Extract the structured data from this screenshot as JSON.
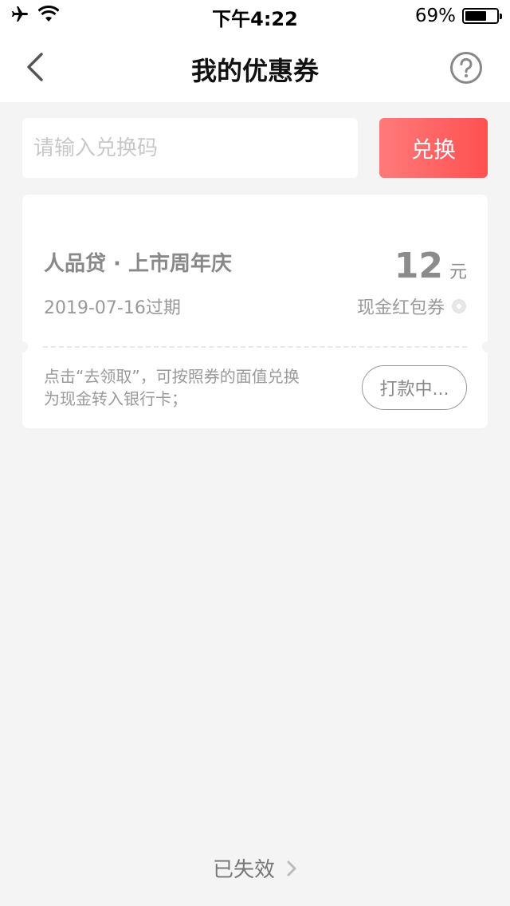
{
  "status_bar": {
    "time": "下午4:22",
    "battery_percent": "69%",
    "battery_level": 0.69,
    "icons": [
      "airplane-icon",
      "wifi-icon",
      "battery-icon"
    ]
  },
  "nav": {
    "title": "我的优惠券",
    "back_icon": "chevron-left-icon",
    "help_icon": "help-circle-icon"
  },
  "redeem": {
    "placeholder": "请输入兑换码",
    "button_label": "兑换"
  },
  "coupons": [
    {
      "name": "人品贷 · 上市周年庆",
      "expiry": "2019-07-16过期",
      "amount": "12",
      "unit": "元",
      "type": "现金红包券",
      "description": "点击“去领取”，可按照券的面值兑换为现金转入银行卡；",
      "status_label": "打款中..."
    }
  ],
  "footer": {
    "expired_label": "已失效"
  },
  "colors": {
    "accent_start": "#ff7a7a",
    "accent_end": "#ff5050",
    "background": "#f4f4f4"
  }
}
